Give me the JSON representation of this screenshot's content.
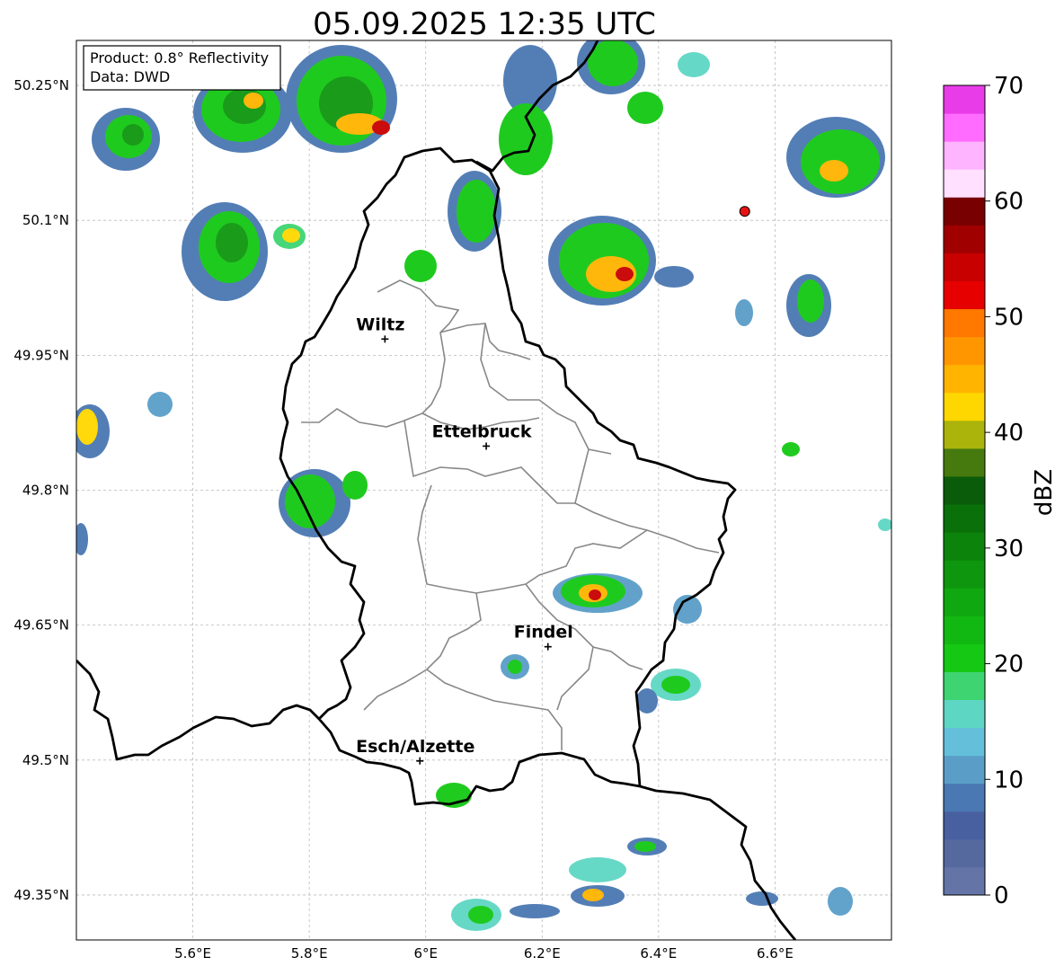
{
  "title": "05.09.2025 12:35 UTC",
  "info_box": {
    "product": "Product: 0.8° Reflectivity",
    "data": "Data: DWD"
  },
  "map": {
    "lon_range": [
      5.4,
      6.8
    ],
    "lat_range": [
      49.3,
      50.3
    ],
    "lon_ticks": [
      {
        "value": 5.6,
        "label": "5.6°E"
      },
      {
        "value": 5.8,
        "label": "5.8°E"
      },
      {
        "value": 6.0,
        "label": "6°E"
      },
      {
        "value": 6.2,
        "label": "6.2°E"
      },
      {
        "value": 6.4,
        "label": "6.4°E"
      },
      {
        "value": 6.6,
        "label": "6.6°E"
      }
    ],
    "lat_ticks": [
      {
        "value": 50.25,
        "label": "50.25°N"
      },
      {
        "value": 50.1,
        "label": "50.1°N"
      },
      {
        "value": 49.95,
        "label": "49.95°N"
      },
      {
        "value": 49.8,
        "label": "49.8°N"
      },
      {
        "value": 49.65,
        "label": "49.65°N"
      },
      {
        "value": 49.5,
        "label": "49.5°N"
      },
      {
        "value": 49.35,
        "label": "49.35°N"
      }
    ],
    "cities": [
      {
        "name": "Wiltz",
        "lon": 5.93,
        "lat": 49.968
      },
      {
        "name": "Ettelbruck",
        "lon": 6.104,
        "lat": 49.849
      },
      {
        "name": "Findel",
        "lon": 6.21,
        "lat": 49.626
      },
      {
        "name": "Esch/Alzette",
        "lon": 5.99,
        "lat": 49.499
      }
    ],
    "radar_site": {
      "lon": 6.548,
      "lat": 50.11,
      "color": "#e81414"
    }
  },
  "colorbar": {
    "label": "dBZ",
    "ticks": [
      "0",
      "10",
      "20",
      "30",
      "40",
      "50",
      "60",
      "70"
    ],
    "colors": [
      "#6474a6",
      "#55699f",
      "#4860a0",
      "#4a78b2",
      "#5a9ec8",
      "#64c0da",
      "#5ed6c4",
      "#3ed472",
      "#14c814",
      "#12b812",
      "#10a810",
      "#0e960e",
      "#0c840c",
      "#0a700a",
      "#0a5c0a",
      "#467a0e",
      "#aab40a",
      "#ffd700",
      "#ffb400",
      "#ff9600",
      "#ff7800",
      "#e60000",
      "#c80000",
      "#a00000",
      "#780000",
      "#ffe0ff",
      "#ffb4ff",
      "#ff6cff",
      "#e83ce8"
    ]
  }
}
